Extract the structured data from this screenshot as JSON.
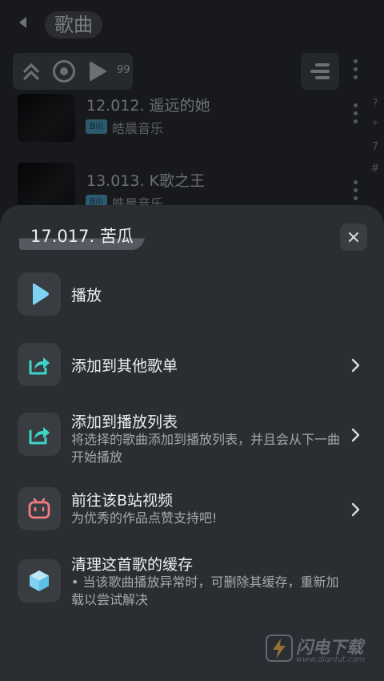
{
  "background_page": {
    "title": "歌曲",
    "control_bar": {
      "count": "99"
    },
    "alpha_index": [
      "?",
      "*",
      "7",
      "#"
    ],
    "songs": [
      {
        "title": "12.012. 遥远的她",
        "source_tag": "Bili",
        "artist": "皓晨音乐"
      },
      {
        "title": "13.013. K歌之王",
        "source_tag": "Bili",
        "artist": "皓晨音乐"
      }
    ]
  },
  "sheet": {
    "title": "17.017. 苦瓜",
    "actions": [
      {
        "label": "播放",
        "icon": "play-icon",
        "color": "#7fd3f2"
      },
      {
        "label": "添加到其他歌单",
        "icon": "share-arrow-icon",
        "color": "#3fd6c8"
      },
      {
        "label": "添加到播放列表",
        "desc": "将选择的歌曲添加到播放列表，并且会从下一曲开始播放",
        "icon": "share-arrow-icon",
        "color": "#3fd6c8"
      },
      {
        "label": "前往该B站视频",
        "desc": "为优秀的作品点赞支持吧!",
        "icon": "bilibili-tv-icon",
        "color": "#f27b82"
      },
      {
        "label": "清理这首歌的缓存",
        "desc": "• 当该歌曲播放异常时，可删除其缓存，重新加载以尝试解决",
        "icon": "cube-icon",
        "color": "#7fd3f2"
      }
    ]
  },
  "watermark": {
    "text": "闪电下载",
    "url": "www.dianlut.com"
  }
}
